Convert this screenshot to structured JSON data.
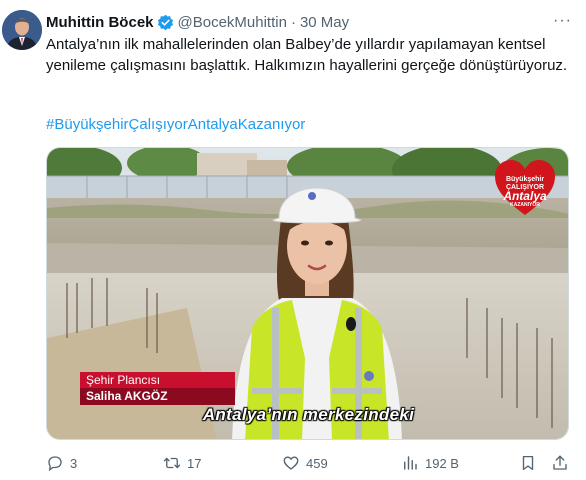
{
  "tweet": {
    "author_name": "Muhittin Böcek",
    "handle": "@BocekMuhittin",
    "separator": "·",
    "date": "30 May",
    "more_label": "···",
    "text": "Antalya’nın ilk mahallelerinden olan Balbey’de yıllardır yapılamayan kentsel yenileme çalışmasını başlattık. Halkımızın hayallerini gerçeğe dönüştürüyoruz.",
    "hashtag": "#BüyükşehirÇalışıyorAntalyaKazanıyor"
  },
  "video": {
    "lower_third_title": "Şehir Plancısı",
    "lower_third_name": "Saliha AKGÖZ",
    "subtitle": "Antalya’nın merkezindeki",
    "logo": {
      "line1": "Büyükşehir",
      "line1b": "ÇALIŞIYOR",
      "line2": "Antalya",
      "line3": "KAZANIYOR"
    }
  },
  "actions": {
    "replies": "3",
    "retweets": "17",
    "likes": "459",
    "views": "192 B"
  },
  "icons": {
    "verified": "verified-badge-icon",
    "reply": "reply-icon",
    "retweet": "retweet-icon",
    "like": "heart-icon",
    "views": "views-icon",
    "bookmark": "bookmark-icon",
    "share": "share-icon"
  },
  "colors": {
    "accent": "#1d9bf0",
    "secondary_text": "#536471",
    "lower_third_red": "#c8102e",
    "vest": "#c8e627"
  }
}
